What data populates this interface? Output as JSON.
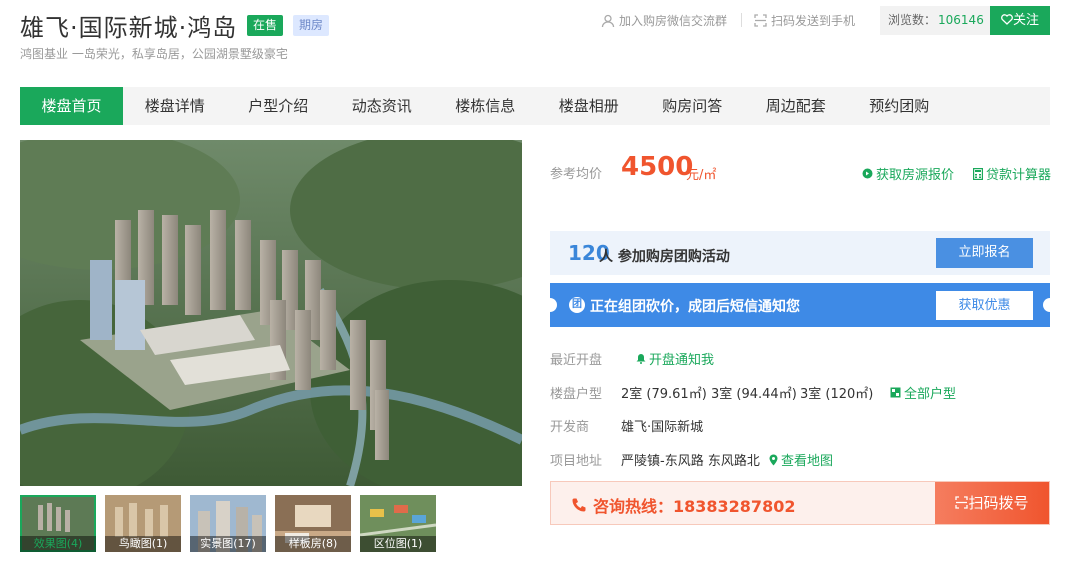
{
  "header": {
    "title": "雄飞·国际新城·鸿岛",
    "status_tag": "在售",
    "type_tag": "期房",
    "subtitle": "鸿图基业 一岛荣光，私享岛居，公园湖景墅级豪宅",
    "join_group_link": "加入购房微信交流群",
    "scan_send_link": "扫码发送到手机",
    "views_label": "浏览数：",
    "views_count": "106146",
    "follow_label": "关注"
  },
  "nav": {
    "tabs": [
      {
        "label": "楼盘首页",
        "active": true
      },
      {
        "label": "楼盘详情"
      },
      {
        "label": "户型介绍"
      },
      {
        "label": "动态资讯"
      },
      {
        "label": "楼栋信息"
      },
      {
        "label": "楼盘相册"
      },
      {
        "label": "购房问答"
      },
      {
        "label": "周边配套"
      },
      {
        "label": "预约团购"
      }
    ]
  },
  "gallery": {
    "thumbs": [
      {
        "label": "效果图(4)",
        "active": true
      },
      {
        "label": "鸟瞰图(1)"
      },
      {
        "label": "实景图(17)"
      },
      {
        "label": "样板房(8)"
      },
      {
        "label": "区位图(1)"
      }
    ]
  },
  "price": {
    "label": "参考均价",
    "value": "4500",
    "unit": "元/㎡",
    "quote_link": "获取房源报价",
    "calc_link": "贷款计算器"
  },
  "group_buy": {
    "count": "120",
    "text": "人 参加购房团购活动",
    "button": "立即报名"
  },
  "promo": {
    "icon": "团",
    "text": "正在组团砍价，成团后短信通知您",
    "button": "获取优惠"
  },
  "info": {
    "opening_label": "最近开盘",
    "opening_link": "开盘通知我",
    "layout_label": "楼盘户型",
    "layouts": [
      "2室 (79.61㎡)",
      "3室 (94.44㎡)",
      "3室 (120㎡)"
    ],
    "layouts_link": "全部户型",
    "developer_label": "开发商",
    "developer": "雄飞·国际新城",
    "address_label": "项目地址",
    "address": "严陵镇-东风路 东风路北",
    "map_link": "查看地图"
  },
  "hotline": {
    "text": "咨询热线：18383287802",
    "button": "扫码拨号"
  },
  "colors": {
    "brand_green": "#1aa85b",
    "price_orange": "#f0552e",
    "promo_blue": "#3e8ae6"
  }
}
